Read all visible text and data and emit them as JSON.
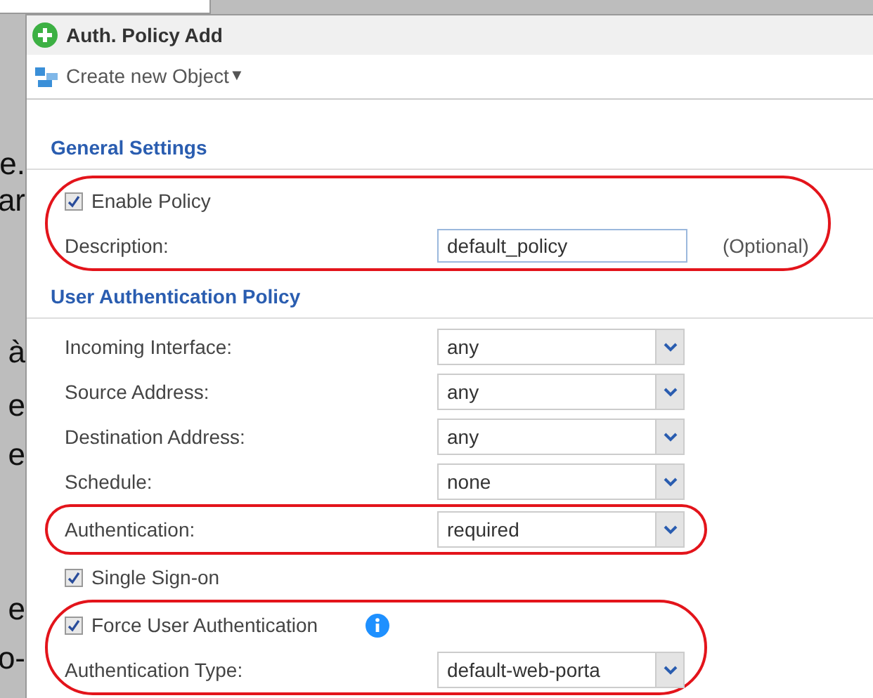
{
  "background_fragments": [
    "e.",
    "ar",
    "à",
    "e",
    "e",
    "e",
    "o-"
  ],
  "dialog": {
    "title": "Auth. Policy Add",
    "toolbar": {
      "label": "Create new Object",
      "caret": "▼"
    }
  },
  "sections": [
    {
      "heading": "General Settings",
      "rows": [
        {
          "kind": "checkbox",
          "label": "Enable Policy",
          "checked": true,
          "circled": true
        },
        {
          "kind": "text_field",
          "label": "Description:",
          "value": "default_policy",
          "note": "(Optional)",
          "circled": true
        }
      ]
    },
    {
      "heading": "User Authentication Policy",
      "rows": [
        {
          "kind": "select",
          "label": "Incoming Interface:",
          "value": "any",
          "circled": false
        },
        {
          "kind": "select",
          "label": "Source Address:",
          "value": "any",
          "circled": false
        },
        {
          "kind": "select",
          "label": "Destination Address:",
          "value": "any",
          "circled": false
        },
        {
          "kind": "select",
          "label": "Schedule:",
          "value": "none",
          "circled": false
        },
        {
          "kind": "select",
          "label": "Authentication:",
          "value": "required",
          "circled": true
        },
        {
          "kind": "checkbox",
          "label": "Single Sign-on",
          "checked": true,
          "circled": false
        },
        {
          "kind": "checkbox",
          "label": "Force User Authentication",
          "checked": true,
          "info": true,
          "circled": true
        },
        {
          "kind": "select",
          "label": "Authentication Type:",
          "value": "default-web-porta",
          "circled": true
        }
      ]
    }
  ]
}
